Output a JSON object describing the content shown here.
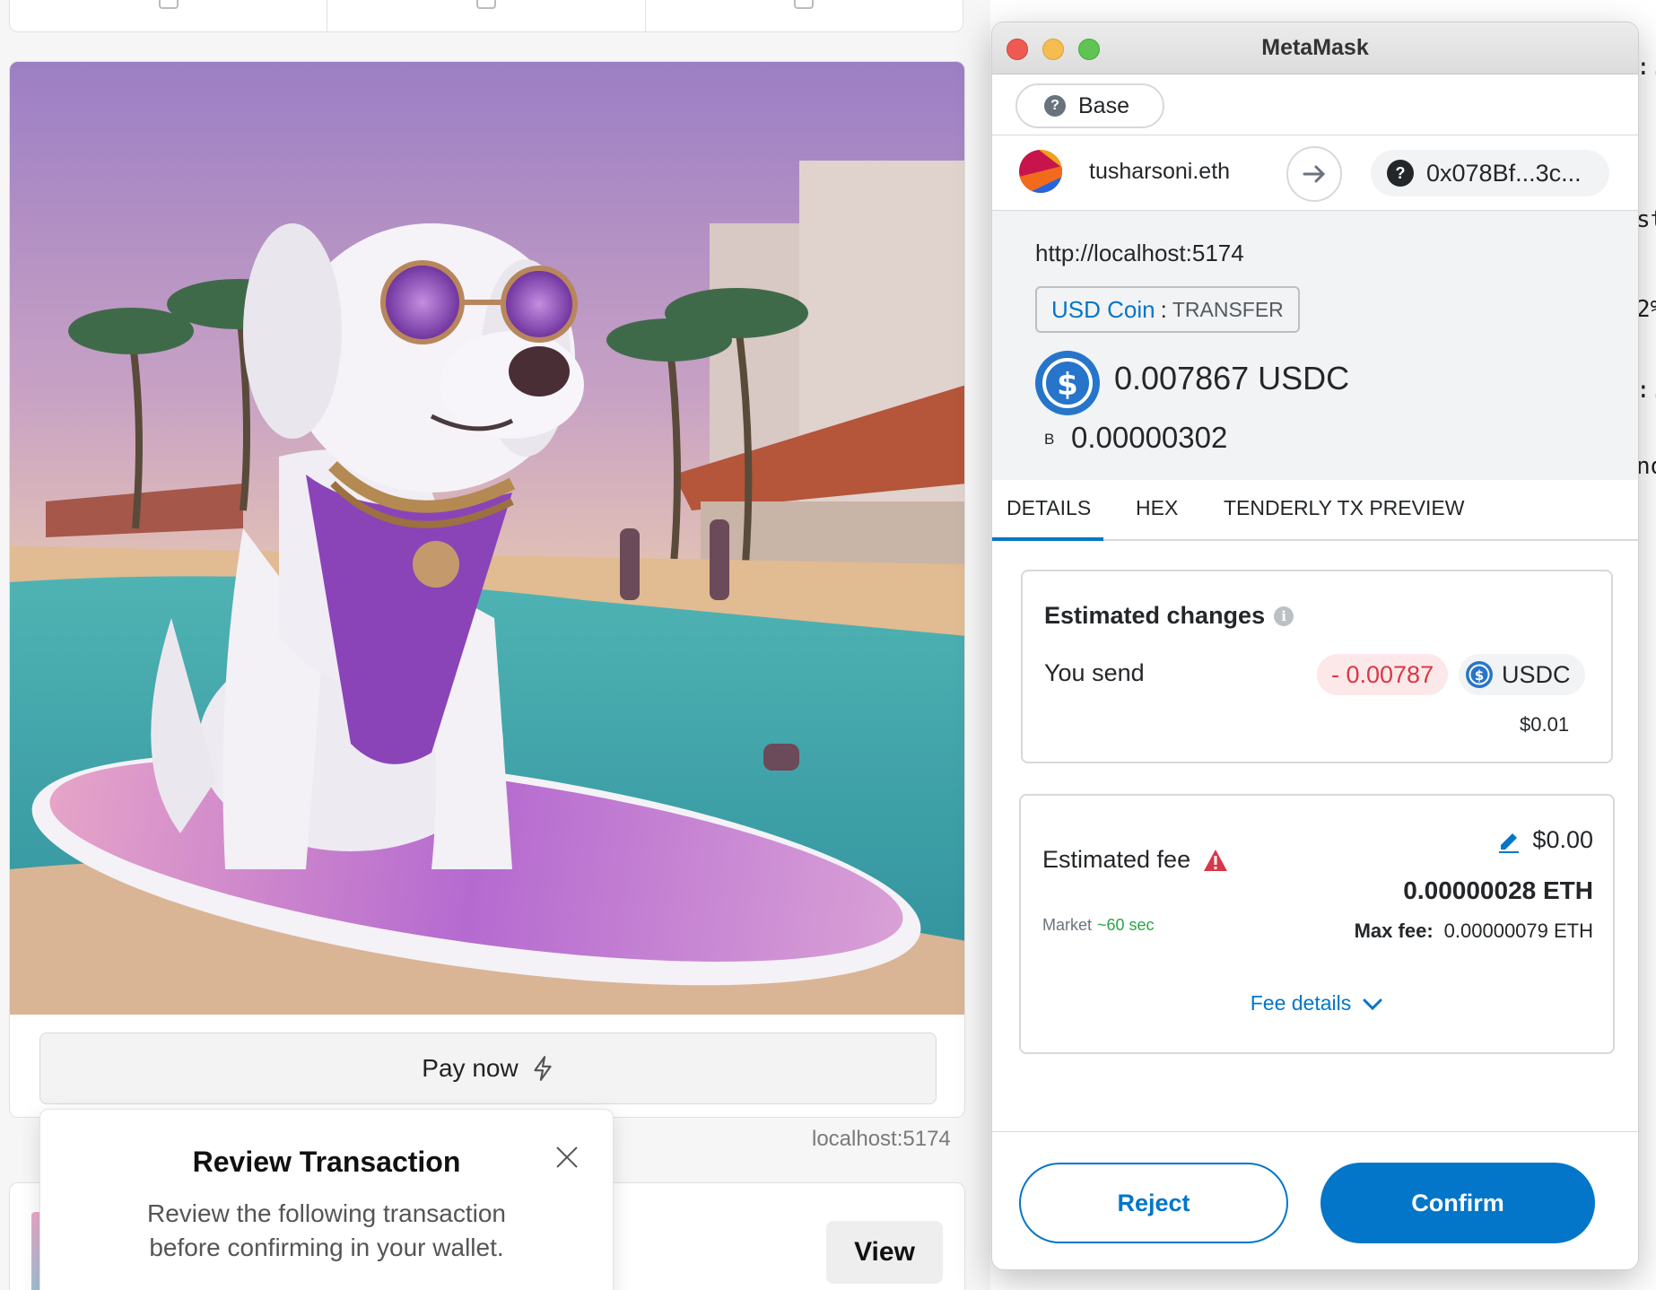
{
  "background_app": {
    "pay_button_label": "Pay now",
    "origin_label": "localhost:5174",
    "review_toast": {
      "title": "Review Transaction",
      "description": "Review the following transaction before confirming in your wallet."
    },
    "view_button_label": "View",
    "nft_image_alt": "white-dog-with-sunglasses-on-surfboard"
  },
  "metamask": {
    "window_title": "MetaMask",
    "network": {
      "name": "Base",
      "icon": "question-icon"
    },
    "from_account": {
      "name": "tusharsoni.eth",
      "icon": "jazzicon"
    },
    "to_address": "0x078Bf...3c...",
    "origin_url": "http://localhost:5174",
    "method": {
      "token": "USD Coin",
      "separator": ":",
      "name": "TRANSFER"
    },
    "amount": "0.007867 USDC",
    "native_symbol": "B",
    "native_amount": "0.00000302",
    "tabs": [
      "DETAILS",
      "HEX",
      "TENDERLY TX PREVIEW"
    ],
    "active_tab": "DETAILS",
    "estimated_changes": {
      "title": "Estimated changes",
      "you_send_label": "You send",
      "delta": "- 0.00787",
      "token": "USDC",
      "fiat": "$0.01"
    },
    "fee": {
      "label": "Estimated fee",
      "fiat": "$0.00",
      "eth": "0.00000028 ETH",
      "market_label": "Market",
      "market_time": "~60 sec",
      "max_fee_label": "Max fee:",
      "max_fee_value": "0.00000079 ETH",
      "details_link": "Fee details"
    },
    "buttons": {
      "reject": "Reject",
      "confirm": "Confirm"
    },
    "colors": {
      "primary": "#0376c9",
      "error": "#d73847",
      "success": "#28a745"
    }
  }
}
